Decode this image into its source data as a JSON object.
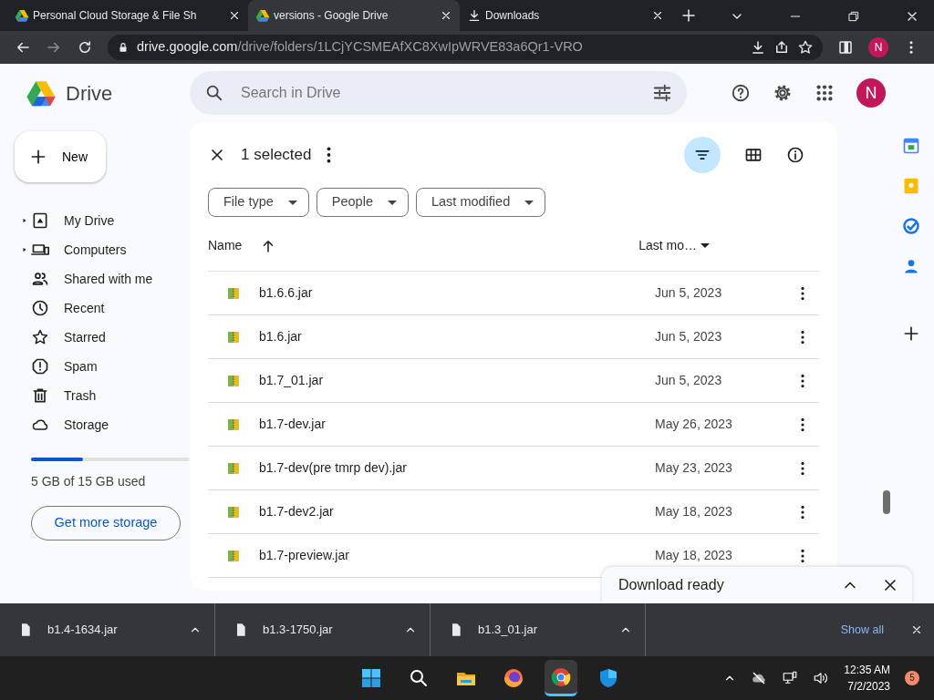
{
  "browser": {
    "tabs": [
      {
        "title": "Personal Cloud Storage & File Sh",
        "kind": "drive",
        "selected": false
      },
      {
        "title": "versions - Google Drive",
        "kind": "drive",
        "selected": true
      },
      {
        "title": "Downloads",
        "kind": "download",
        "selected": false
      }
    ],
    "url_host": "drive.google.com",
    "url_path": "/drive/folders/1LCjYCSMEAfXC8XwIpWRVE83a6Qr1-VRO",
    "profile_letter": "N"
  },
  "drive": {
    "logo_text": "Drive",
    "search_placeholder": "Search in Drive",
    "account_letter": "N",
    "new_button": "New",
    "nav": [
      {
        "label": "My Drive",
        "expandable": true
      },
      {
        "label": "Computers",
        "expandable": true
      },
      {
        "label": "Shared with me",
        "expandable": false
      },
      {
        "label": "Recent",
        "expandable": false
      },
      {
        "label": "Starred",
        "expandable": false
      },
      {
        "label": "Spam",
        "expandable": false
      },
      {
        "label": "Trash",
        "expandable": false
      },
      {
        "label": "Storage",
        "expandable": false
      }
    ],
    "storage": {
      "level": 0.33,
      "text": "5 GB of 15 GB used"
    },
    "get_more": "Get more storage",
    "selection": "1 selected",
    "filters": [
      "File type",
      "People",
      "Last modified"
    ],
    "columns": {
      "name": "Name",
      "modified": "Last mo…"
    },
    "files": [
      {
        "name": "b1.6.6.jar",
        "modified": "Jun 5, 2023"
      },
      {
        "name": "b1.6.jar",
        "modified": "Jun 5, 2023"
      },
      {
        "name": "b1.7_01.jar",
        "modified": "Jun 5, 2023"
      },
      {
        "name": "b1.7-dev.jar",
        "modified": "May 26, 2023"
      },
      {
        "name": "b1.7-dev(pre tmrp dev).jar",
        "modified": "May 23, 2023"
      },
      {
        "name": "b1.7-dev2.jar",
        "modified": "May 18, 2023"
      },
      {
        "name": "b1.7-preview.jar",
        "modified": "May 18, 2023"
      }
    ],
    "download_popup": "Download ready"
  },
  "downloads_bar": {
    "items": [
      "b1.4-1634.jar",
      "b1.3-1750.jar",
      "b1.3_01.jar"
    ],
    "show_all": "Show all"
  },
  "taskbar": {
    "apps": [
      {
        "kind": "windows",
        "active": false
      },
      {
        "kind": "search",
        "active": false
      },
      {
        "kind": "explorer",
        "active": false
      },
      {
        "kind": "firefox",
        "active": false
      },
      {
        "kind": "chrome",
        "active": true
      },
      {
        "kind": "shield",
        "active": false
      }
    ],
    "time": "12:35 AM",
    "date": "7/2/2023",
    "notifications": "5"
  }
}
